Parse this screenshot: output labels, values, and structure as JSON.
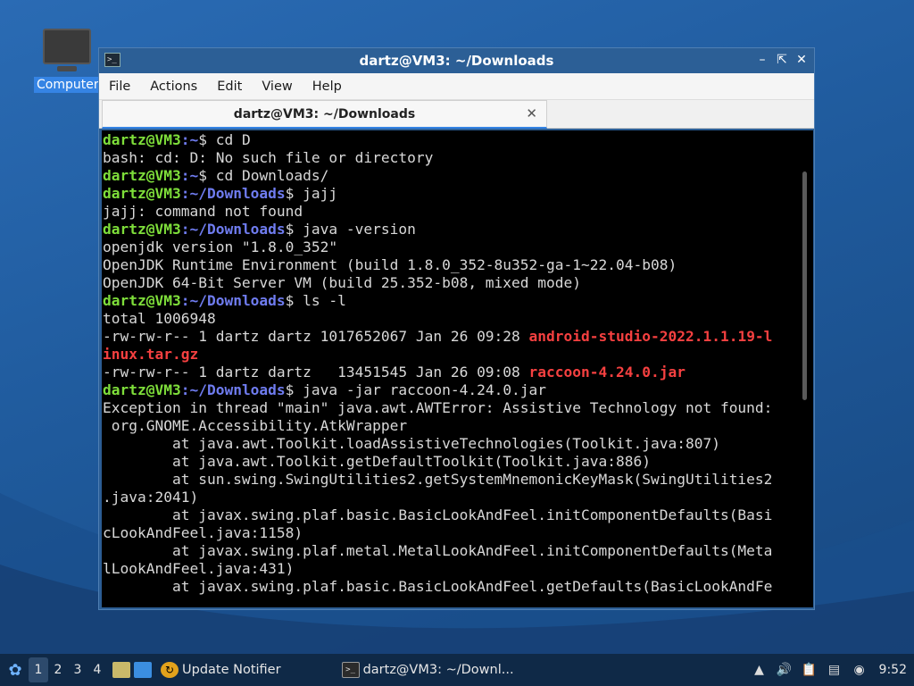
{
  "desktop": {
    "icon_label": "Computer"
  },
  "window": {
    "title": "dartz@VM3: ~/Downloads",
    "menu": [
      "File",
      "Actions",
      "Edit",
      "View",
      "Help"
    ],
    "tab_label": "dartz@VM3: ~/Downloads"
  },
  "terminal": {
    "lines": [
      {
        "segs": [
          {
            "t": "dartz@VM3",
            "c": "user"
          },
          {
            "t": ":~",
            "c": "path"
          },
          {
            "t": "$ cd D",
            "c": ""
          }
        ]
      },
      {
        "segs": [
          {
            "t": "bash: cd: D: No such file or directory",
            "c": ""
          }
        ]
      },
      {
        "segs": [
          {
            "t": "dartz@VM3",
            "c": "user"
          },
          {
            "t": ":~",
            "c": "path"
          },
          {
            "t": "$ cd Downloads/",
            "c": ""
          }
        ]
      },
      {
        "segs": [
          {
            "t": "dartz@VM3",
            "c": "user"
          },
          {
            "t": ":~/Downloads",
            "c": "path"
          },
          {
            "t": "$ jajj",
            "c": ""
          }
        ]
      },
      {
        "segs": [
          {
            "t": "jajj: command not found",
            "c": ""
          }
        ]
      },
      {
        "segs": [
          {
            "t": "dartz@VM3",
            "c": "user"
          },
          {
            "t": ":~/Downloads",
            "c": "path"
          },
          {
            "t": "$ java -version",
            "c": ""
          }
        ]
      },
      {
        "segs": [
          {
            "t": "openjdk version \"1.8.0_352\"",
            "c": ""
          }
        ]
      },
      {
        "segs": [
          {
            "t": "OpenJDK Runtime Environment (build 1.8.0_352-8u352-ga-1~22.04-b08)",
            "c": ""
          }
        ]
      },
      {
        "segs": [
          {
            "t": "OpenJDK 64-Bit Server VM (build 25.352-b08, mixed mode)",
            "c": ""
          }
        ]
      },
      {
        "segs": [
          {
            "t": "dartz@VM3",
            "c": "user"
          },
          {
            "t": ":~/Downloads",
            "c": "path"
          },
          {
            "t": "$ ls -l",
            "c": ""
          }
        ]
      },
      {
        "segs": [
          {
            "t": "total 1006948",
            "c": ""
          }
        ]
      },
      {
        "segs": [
          {
            "t": "-rw-rw-r-- 1 dartz dartz 1017652067 Jan 26 09:28 ",
            "c": ""
          },
          {
            "t": "android-studio-2022.1.1.19-l",
            "c": "red"
          }
        ]
      },
      {
        "segs": [
          {
            "t": "inux.tar.gz",
            "c": "red"
          }
        ]
      },
      {
        "segs": [
          {
            "t": "-rw-rw-r-- 1 dartz dartz   13451545 Jan 26 09:08 ",
            "c": ""
          },
          {
            "t": "raccoon-4.24.0.jar",
            "c": "red"
          }
        ]
      },
      {
        "segs": [
          {
            "t": "dartz@VM3",
            "c": "user"
          },
          {
            "t": ":~/Downloads",
            "c": "path"
          },
          {
            "t": "$ java -jar raccoon-4.24.0.jar",
            "c": ""
          }
        ]
      },
      {
        "segs": [
          {
            "t": "Exception in thread \"main\" java.awt.AWTError: Assistive Technology not found:",
            "c": ""
          }
        ]
      },
      {
        "segs": [
          {
            "t": " org.GNOME.Accessibility.AtkWrapper",
            "c": ""
          }
        ]
      },
      {
        "segs": [
          {
            "t": "        at java.awt.Toolkit.loadAssistiveTechnologies(Toolkit.java:807)",
            "c": ""
          }
        ]
      },
      {
        "segs": [
          {
            "t": "        at java.awt.Toolkit.getDefaultToolkit(Toolkit.java:886)",
            "c": ""
          }
        ]
      },
      {
        "segs": [
          {
            "t": "        at sun.swing.SwingUtilities2.getSystemMnemonicKeyMask(SwingUtilities2",
            "c": ""
          }
        ]
      },
      {
        "segs": [
          {
            "t": ".java:2041)",
            "c": ""
          }
        ]
      },
      {
        "segs": [
          {
            "t": "        at javax.swing.plaf.basic.BasicLookAndFeel.initComponentDefaults(Basi",
            "c": ""
          }
        ]
      },
      {
        "segs": [
          {
            "t": "cLookAndFeel.java:1158)",
            "c": ""
          }
        ]
      },
      {
        "segs": [
          {
            "t": "        at javax.swing.plaf.metal.MetalLookAndFeel.initComponentDefaults(Meta",
            "c": ""
          }
        ]
      },
      {
        "segs": [
          {
            "t": "lLookAndFeel.java:431)",
            "c": ""
          }
        ]
      },
      {
        "segs": [
          {
            "t": "        at javax.swing.plaf.basic.BasicLookAndFeel.getDefaults(BasicLookAndFe",
            "c": ""
          }
        ]
      }
    ]
  },
  "taskbar": {
    "workspaces": [
      "1",
      "2",
      "3",
      "4"
    ],
    "active_workspace": "1",
    "update_notifier_label": "Update Notifier",
    "terminal_task_label": "dartz@VM3: ~/Downl...",
    "clock": "9:52"
  },
  "colors": {
    "prompt_user": "#7ede3a",
    "prompt_path": "#6f7cf0",
    "archive_red": "#f54040",
    "desktop_bg": "#1f5a9c",
    "taskbar_bg": "#0f2947"
  }
}
